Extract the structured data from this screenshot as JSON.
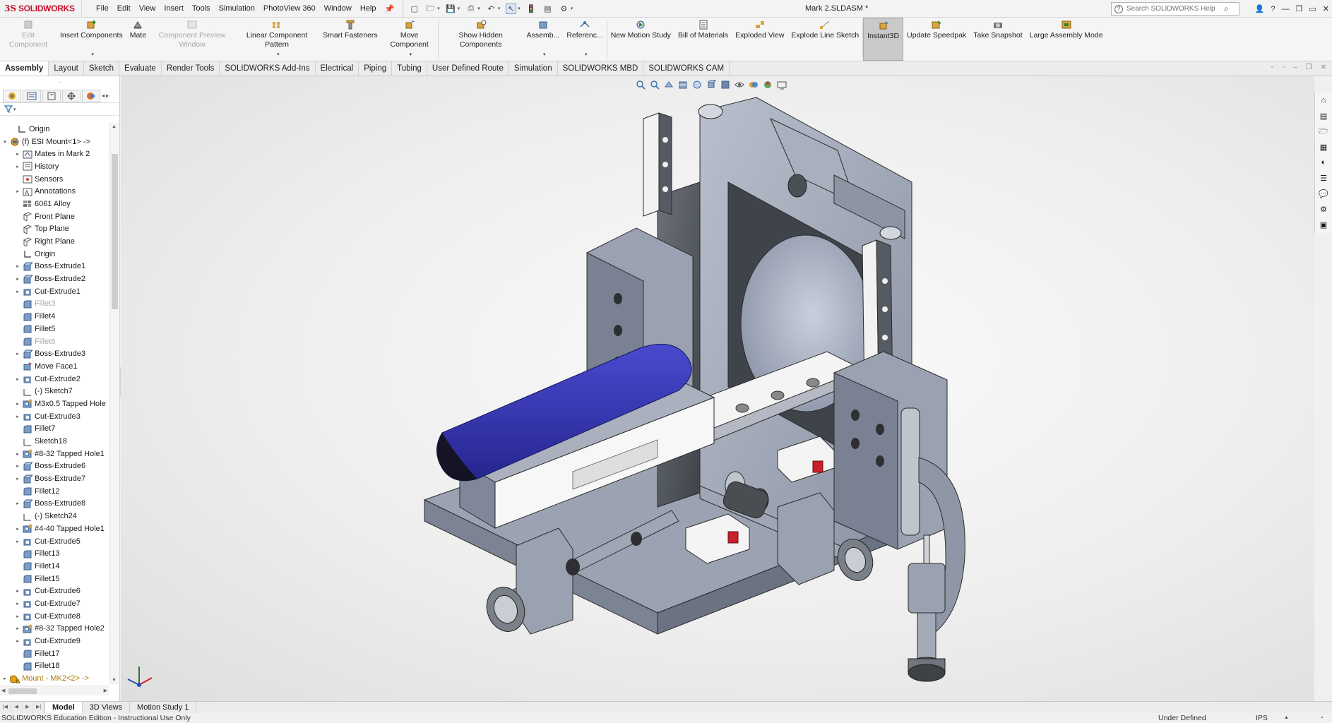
{
  "app": {
    "brand_prefix": "3S",
    "brand": "SOLIDWORKS",
    "doc_title": "Mark 2.SLDASM *"
  },
  "menu": [
    "File",
    "Edit",
    "View",
    "Insert",
    "Tools",
    "Simulation",
    "PhotoView 360",
    "Window",
    "Help"
  ],
  "search": {
    "placeholder": "Search SOLIDWORKS Help",
    "help_glyph": "?"
  },
  "commands": [
    {
      "label": "Edit Component",
      "icon": "edit-component-icon",
      "disabled": true
    },
    {
      "label": "Insert Components",
      "icon": "insert-components-icon",
      "dropdown": true
    },
    {
      "label": "Mate",
      "icon": "mate-icon"
    },
    {
      "label": "Component Preview Window",
      "icon": "preview-window-icon",
      "disabled": true
    },
    {
      "label": "Linear Component Pattern",
      "icon": "linear-pattern-icon",
      "dropdown": true
    },
    {
      "label": "Smart Fasteners",
      "icon": "smart-fasteners-icon"
    },
    {
      "label": "Move Component",
      "icon": "move-component-icon",
      "dropdown": true
    },
    {
      "label": "Show Hidden Components",
      "icon": "show-hidden-icon"
    },
    {
      "label": "Assemb...",
      "icon": "assembly-features-icon",
      "dropdown": true
    },
    {
      "label": "Referenc...",
      "icon": "reference-geometry-icon",
      "dropdown": true
    },
    {
      "label": "New Motion Study",
      "icon": "motion-study-icon"
    },
    {
      "label": "Bill of Materials",
      "icon": "bom-icon"
    },
    {
      "label": "Exploded View",
      "icon": "exploded-view-icon"
    },
    {
      "label": "Explode Line Sketch",
      "icon": "explode-line-icon"
    },
    {
      "label": "Instant3D",
      "icon": "instant3d-icon",
      "active": true
    },
    {
      "label": "Update Speedpak",
      "icon": "speedpak-icon"
    },
    {
      "label": "Take Snapshot",
      "icon": "snapshot-icon"
    },
    {
      "label": "Large Assembly Mode",
      "icon": "large-assembly-icon"
    }
  ],
  "tabs": [
    "Assembly",
    "Layout",
    "Sketch",
    "Evaluate",
    "Render Tools",
    "SOLIDWORKS Add-Ins",
    "Electrical",
    "Piping",
    "Tubing",
    "User Defined Route",
    "Simulation",
    "SOLIDWORKS MBD",
    "SOLIDWORKS CAM"
  ],
  "tree": [
    {
      "label": "Origin",
      "icon": "origin-icon",
      "level": 1
    },
    {
      "label": "(f) ESI Mount<1> ->",
      "icon": "part-icon",
      "level": 0,
      "expanded": true
    },
    {
      "label": "Mates in Mark 2",
      "icon": "mates-icon",
      "level": 2,
      "toggle": true
    },
    {
      "label": "History",
      "icon": "history-icon",
      "level": 2,
      "toggle": true
    },
    {
      "label": "Sensors",
      "icon": "sensors-icon",
      "level": 2
    },
    {
      "label": "Annotations",
      "icon": "annotations-icon",
      "level": 2,
      "toggle": true
    },
    {
      "label": "6061 Alloy",
      "icon": "material-icon",
      "level": 2
    },
    {
      "label": "Front Plane",
      "icon": "plane-icon",
      "level": 2
    },
    {
      "label": "Top Plane",
      "icon": "plane-icon",
      "level": 2
    },
    {
      "label": "Right Plane",
      "icon": "plane-icon",
      "level": 2
    },
    {
      "label": "Origin",
      "icon": "origin-icon",
      "level": 2
    },
    {
      "label": "Boss-Extrude1",
      "icon": "boss-extrude-icon",
      "level": 2,
      "toggle": true
    },
    {
      "label": "Boss-Extrude2",
      "icon": "boss-extrude-icon",
      "level": 2,
      "toggle": true
    },
    {
      "label": "Cut-Extrude1",
      "icon": "cut-extrude-icon",
      "level": 2,
      "toggle": true
    },
    {
      "label": "Fillet3",
      "icon": "fillet-icon",
      "level": 2,
      "dim": true
    },
    {
      "label": "Fillet4",
      "icon": "fillet-icon",
      "level": 2
    },
    {
      "label": "Fillet5",
      "icon": "fillet-icon",
      "level": 2
    },
    {
      "label": "Fillet6",
      "icon": "fillet-icon",
      "level": 2,
      "dim": true
    },
    {
      "label": "Boss-Extrude3",
      "icon": "boss-extrude-icon",
      "level": 2,
      "toggle": true
    },
    {
      "label": "Move Face1",
      "icon": "move-face-icon",
      "level": 2
    },
    {
      "label": "Cut-Extrude2",
      "icon": "cut-extrude-icon",
      "level": 2,
      "toggle": true
    },
    {
      "label": "(-) Sketch7",
      "icon": "sketch-icon",
      "level": 2
    },
    {
      "label": "M3x0.5 Tapped Hole",
      "icon": "hole-icon",
      "level": 2,
      "toggle": true
    },
    {
      "label": "Cut-Extrude3",
      "icon": "cut-extrude-icon",
      "level": 2,
      "toggle": true
    },
    {
      "label": "Fillet7",
      "icon": "fillet-icon",
      "level": 2
    },
    {
      "label": "Sketch18",
      "icon": "sketch-icon",
      "level": 2
    },
    {
      "label": "#8-32 Tapped Hole1",
      "icon": "hole-icon",
      "level": 2,
      "toggle": true
    },
    {
      "label": "Boss-Extrude6",
      "icon": "boss-extrude-icon",
      "level": 2,
      "toggle": true
    },
    {
      "label": "Boss-Extrude7",
      "icon": "boss-extrude-icon",
      "level": 2,
      "toggle": true
    },
    {
      "label": "Fillet12",
      "icon": "fillet-icon",
      "level": 2
    },
    {
      "label": "Boss-Extrude8",
      "icon": "boss-extrude-icon",
      "level": 2,
      "toggle": true
    },
    {
      "label": "(-) Sketch24",
      "icon": "sketch-icon",
      "level": 2
    },
    {
      "label": "#4-40 Tapped Hole1",
      "icon": "hole-icon",
      "level": 2,
      "toggle": true
    },
    {
      "label": "Cut-Extrude5",
      "icon": "cut-extrude-icon",
      "level": 2,
      "toggle": true
    },
    {
      "label": "Fillet13",
      "icon": "fillet-icon",
      "level": 2
    },
    {
      "label": "Fillet14",
      "icon": "fillet-icon",
      "level": 2
    },
    {
      "label": "Fillet15",
      "icon": "fillet-icon",
      "level": 2
    },
    {
      "label": "Cut-Extrude6",
      "icon": "cut-extrude-icon",
      "level": 2,
      "toggle": true
    },
    {
      "label": "Cut-Extrude7",
      "icon": "cut-extrude-icon",
      "level": 2,
      "toggle": true
    },
    {
      "label": "Cut-Extrude8",
      "icon": "cut-extrude-icon",
      "level": 2,
      "toggle": true
    },
    {
      "label": "#8-32 Tapped Hole2",
      "icon": "hole-icon",
      "level": 2,
      "toggle": true
    },
    {
      "label": "Cut-Extrude9",
      "icon": "cut-extrude-icon",
      "level": 2,
      "toggle": true
    },
    {
      "label": "Fillet17",
      "icon": "fillet-icon",
      "level": 2
    },
    {
      "label": "Fillet18",
      "icon": "fillet-icon",
      "level": 2
    },
    {
      "label": "Mount - MK2<2> ->",
      "icon": "part-warning-icon",
      "level": 0,
      "toggle": true,
      "warn": true
    }
  ],
  "bottom_tabs": [
    "Model",
    "3D Views",
    "Motion Study 1"
  ],
  "status": {
    "left": "SOLIDWORKS Education Edition - Instructional Use Only",
    "state": "Under Defined",
    "units": "IPS"
  },
  "colors": {
    "accent": "#c8102e",
    "highlight_part": "#2e2fa8",
    "active_cmd": "#c9c9c9"
  }
}
